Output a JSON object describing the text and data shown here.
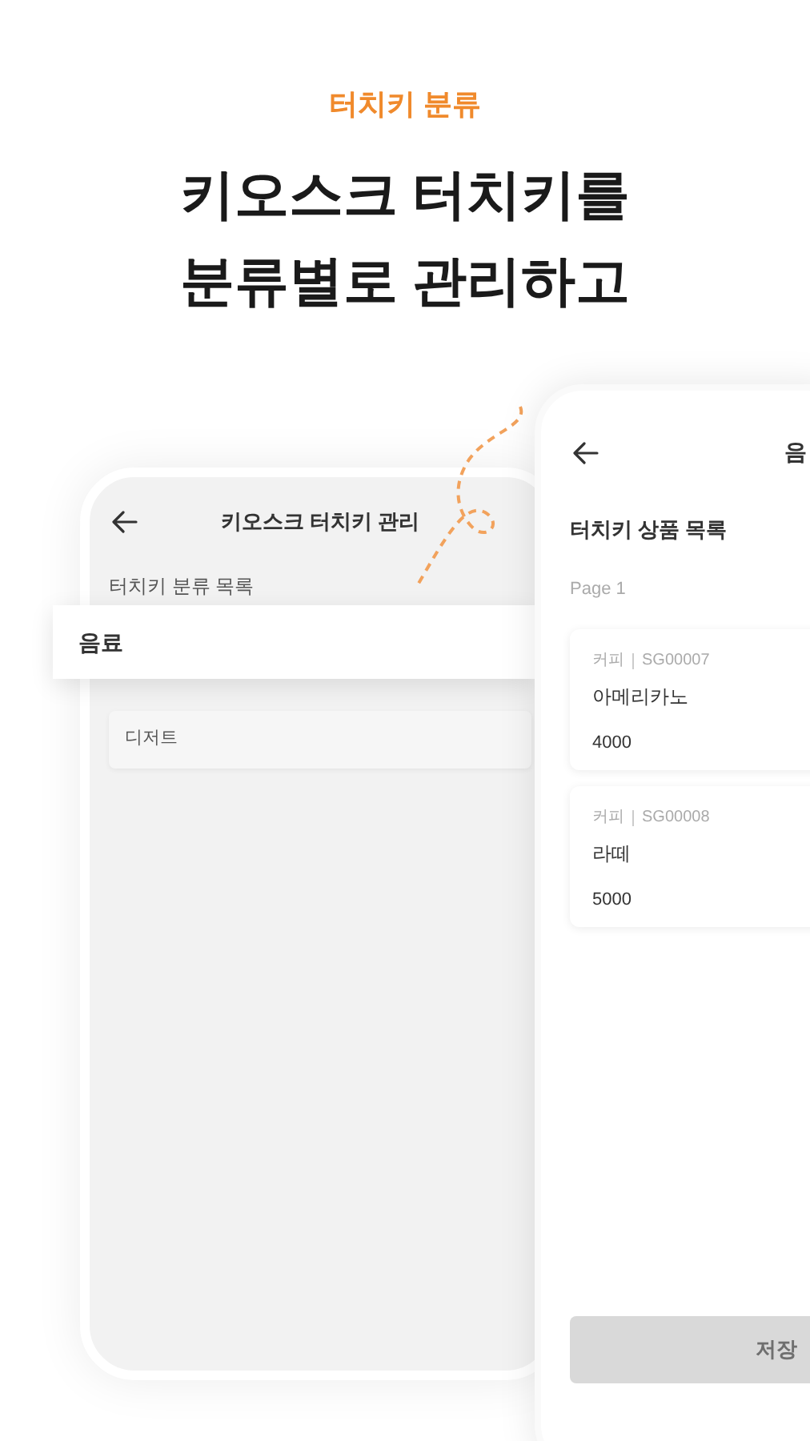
{
  "header": {
    "eyebrow": "터치키 분류",
    "title_lines": [
      "키오스크 터치키를",
      "분류별로 관리하고"
    ]
  },
  "left_screen": {
    "title": "키오스크 터치키 관리",
    "section": "터치키 분류 목록",
    "categories": [
      {
        "label": "음료",
        "selected": true
      },
      {
        "label": "디저트",
        "selected": false
      }
    ]
  },
  "right_screen": {
    "title": "음",
    "section": "터치키 상품 목록",
    "page": "Page 1",
    "products": [
      {
        "category": "커피",
        "code": "SG00007",
        "name": "아메리카노",
        "price": "4000"
      },
      {
        "category": "커피",
        "code": "SG00008",
        "name": "라떼",
        "price": "5000"
      }
    ],
    "save_button": {
      "label": "저장",
      "disabled": true
    }
  }
}
